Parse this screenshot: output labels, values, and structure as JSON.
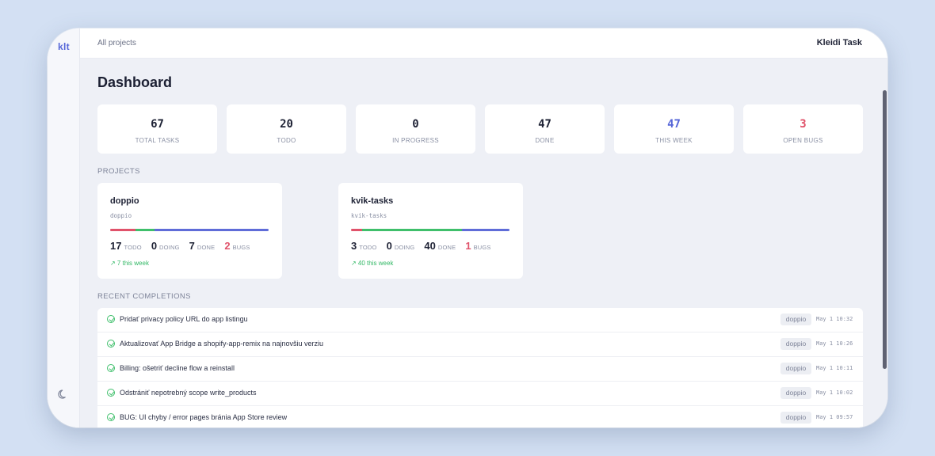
{
  "app": {
    "logo": "klt",
    "breadcrumb": "All projects",
    "brand": "Kleidi Task"
  },
  "page": {
    "title": "Dashboard"
  },
  "stats": [
    {
      "value": "67",
      "label": "TOTAL TASKS",
      "color": "#1e2235"
    },
    {
      "value": "20",
      "label": "TODO",
      "color": "#1e2235"
    },
    {
      "value": "0",
      "label": "IN PROGRESS",
      "color": "#1e2235"
    },
    {
      "value": "47",
      "label": "DONE",
      "color": "#1e2235"
    },
    {
      "value": "47",
      "label": "THIS WEEK",
      "color": "#5666d8"
    },
    {
      "value": "3",
      "label": "OPEN BUGS",
      "color": "#e0526a"
    }
  ],
  "sections": {
    "projects": "PROJECTS",
    "recent": "RECENT COMPLETIONS"
  },
  "projects": [
    {
      "name": "doppio",
      "slug": "doppio",
      "todo": "17",
      "todo_label": "TODO",
      "doing": "0",
      "doing_label": "DOING",
      "done": "7",
      "done_label": "DONE",
      "bugs": "2",
      "bugs_label": "BUGS",
      "week": "↗ 7 this week",
      "progress": {
        "todo_fraction": 0.16,
        "done_green_fraction": 0.12,
        "done_blue_fraction": 0.72
      }
    },
    {
      "name": "kvik-tasks",
      "slug": "kvik-tasks",
      "todo": "3",
      "todo_label": "TODO",
      "doing": "0",
      "doing_label": "DOING",
      "done": "40",
      "done_label": "DONE",
      "bugs": "1",
      "bugs_label": "BUGS",
      "week": "↗ 40 this week",
      "progress": {
        "todo_fraction": 0.07,
        "done_green_fraction": 0.63,
        "done_blue_fraction": 0.3
      }
    }
  ],
  "completions": [
    {
      "text": "Pridať privacy policy URL do app listingu",
      "project": "doppio",
      "time": "May 1 10:32"
    },
    {
      "text": "Aktualizovať App Bridge a shopify-app-remix na najnovšiu verziu",
      "project": "doppio",
      "time": "May 1 10:26"
    },
    {
      "text": "Billing: ošetriť decline flow a reinstall",
      "project": "doppio",
      "time": "May 1 10:11"
    },
    {
      "text": "Odstrániť nepotrebný scope write_products",
      "project": "doppio",
      "time": "May 1 10:02"
    },
    {
      "text": "BUG: UI chyby / error pages bránia App Store review",
      "project": "doppio",
      "time": "May 1 09:57"
    }
  ],
  "colors": {
    "accent": "#5666d8",
    "bug": "#e0526a",
    "done_green": "#3fbf6b"
  },
  "icons": {
    "theme_toggle": "moon-icon",
    "completion": "check-circle-icon",
    "trend": "trend-up-icon"
  }
}
